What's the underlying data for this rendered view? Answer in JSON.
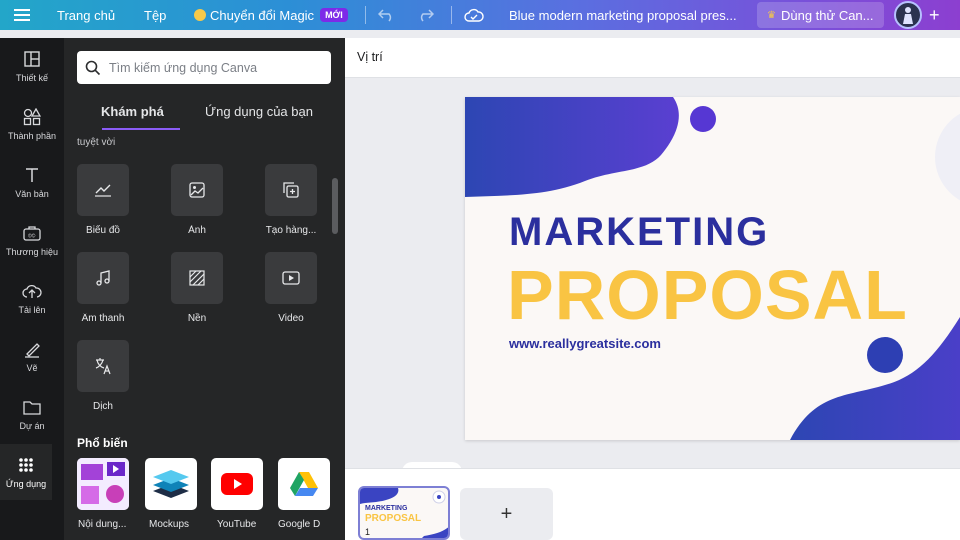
{
  "topbar": {
    "home": "Trang chủ",
    "file": "Tệp",
    "magic": "Chuyển đổi Magic",
    "new_badge": "MỚI",
    "doc_title": "Blue modern marketing proposal pres...",
    "trial": "Dùng thử Can...",
    "add": "+"
  },
  "rail": {
    "items": [
      {
        "label": "Thiết kế",
        "icon": "layout-icon"
      },
      {
        "label": "Thành phần",
        "icon": "shapes-icon"
      },
      {
        "label": "Văn bản",
        "icon": "text-icon"
      },
      {
        "label": "Thương hiệu",
        "icon": "brand-icon"
      },
      {
        "label": "Tải lên",
        "icon": "upload-icon"
      },
      {
        "label": "Vẽ",
        "icon": "draw-icon"
      },
      {
        "label": "Dự án",
        "icon": "folder-icon"
      },
      {
        "label": "Ứng dụng",
        "icon": "apps-icon"
      }
    ]
  },
  "panel": {
    "search_placeholder": "Tìm kiếm ứng dụng Canva",
    "tabs": [
      "Khám phá",
      "Ứng dụng của bạn"
    ],
    "faded_line": "tuyệt vời",
    "apps": [
      {
        "label": "Biểu đồ",
        "icon": "chart-icon"
      },
      {
        "label": "Ảnh",
        "icon": "image-icon"
      },
      {
        "label": "Tạo hàng...",
        "icon": "batch-icon"
      },
      {
        "label": "Âm thanh",
        "icon": "music-icon"
      },
      {
        "label": "Nền",
        "icon": "pattern-icon"
      },
      {
        "label": "Video",
        "icon": "video-icon"
      },
      {
        "label": "Dịch",
        "icon": "translate-icon"
      }
    ],
    "popular_title": "Phổ biến",
    "popular": [
      {
        "label": "Nội dung...",
        "icon": "mockup-content-icon"
      },
      {
        "label": "Mockups",
        "icon": "layers-icon"
      },
      {
        "label": "YouTube",
        "icon": "youtube-icon"
      },
      {
        "label": "Google D",
        "icon": "google-drive-icon"
      }
    ]
  },
  "canvas": {
    "toolbar_label": "Vị trí",
    "slide": {
      "title_line1": "MARKETING",
      "title_line2": "PROPOSAL",
      "website": "www.reallygreatsite.com"
    }
  },
  "pages": {
    "current_page": "1",
    "thumb_line1": "MARKETING",
    "thumb_line2": "PROPOSAL",
    "add_page": "+"
  },
  "colors": {
    "accent": "#8b5cf6",
    "slide_blue": "#2b2f9e",
    "slide_yellow": "#f9c443"
  }
}
